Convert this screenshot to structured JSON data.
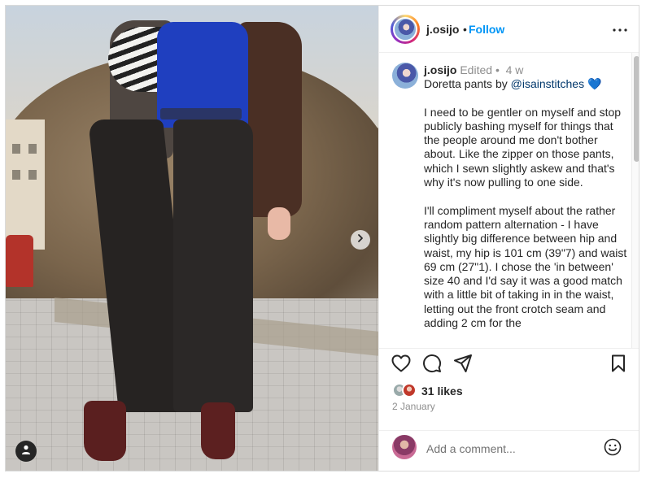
{
  "header": {
    "username": "j.osijo",
    "separator": "•",
    "follow_label": "Follow",
    "more_icon": "more-horizontal-icon"
  },
  "post": {
    "username": "j.osijo",
    "edited_label": "Edited",
    "separator": "•",
    "age": "4 w",
    "caption_prefix": "Doretta pants by ",
    "mention": "@isainstitches",
    "heart_emoji": "💙",
    "paragraphs": [
      "I need to be gentler on myself and stop publicly bashing myself for things that the people around me don't bother about. Like the zipper on those pants, which I sewn slightly askew and that's why it's now pulling to one side.",
      "I'll compliment myself about the rather random pattern alternation - I have slightly big difference between hip and waist, my hip is 101 cm (39\"7) and waist 69 cm (27\"1). I chose the 'in between' size 40 and I'd say it was a good match with a little bit of taking in in the waist, letting out the front crotch seam and adding 2 cm for the"
    ]
  },
  "actions": {
    "like_icon": "heart-icon",
    "comment_icon": "comment-icon",
    "share_icon": "send-icon",
    "save_icon": "bookmark-icon"
  },
  "likes": {
    "count_label": "31 likes"
  },
  "date": "2 January",
  "comment_box": {
    "placeholder": "Add a comment...",
    "emoji_icon": "smiley-icon"
  },
  "photo": {
    "next_icon": "chevron-right-icon",
    "tag_icon": "user-tag-icon"
  },
  "colors": {
    "accent": "#0095f6",
    "text": "#262626",
    "muted": "#8e8e8e",
    "border": "#dbdbdb",
    "mention": "#00376b"
  }
}
